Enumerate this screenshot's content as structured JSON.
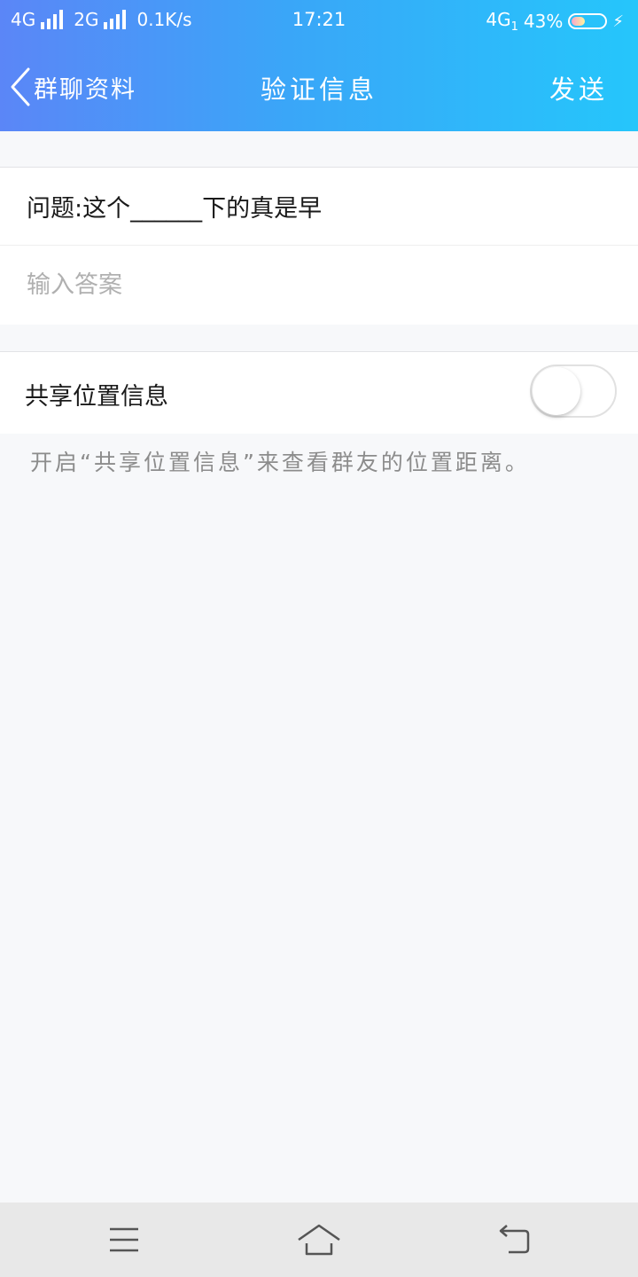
{
  "status_bar": {
    "network1": "4G",
    "network2": "2G",
    "speed": "0.1K/s",
    "time": "17:21",
    "network_right": "4G",
    "sim_index": "1",
    "battery_percent": "43%",
    "battery_level": 0.43
  },
  "nav": {
    "back_label": "群聊资料",
    "title": "验证信息",
    "send_label": "发送"
  },
  "verify": {
    "question": "问题:这个______下的真是早",
    "answer_value": "",
    "answer_placeholder": "输入答案"
  },
  "location": {
    "label": "共享位置信息",
    "enabled": false,
    "hint": "开启“共享位置信息”来查看群友的位置距离。"
  },
  "icons": {
    "back": "chevron-left-icon",
    "menu": "menu-icon",
    "home": "home-icon",
    "return": "return-icon"
  }
}
